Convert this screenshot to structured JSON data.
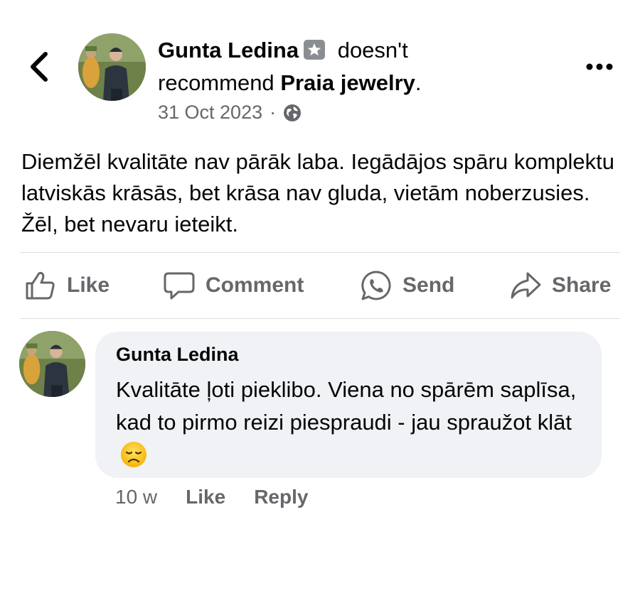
{
  "post": {
    "author": "Gunta Ledina",
    "verb": "doesn't",
    "recommend_word": "recommend",
    "page": "Praia jewelry",
    "page_suffix": ".",
    "date": "31 Oct 2023",
    "date_separator": "·",
    "privacy_icon": "globe-icon",
    "text": "Diemžēl kvalitāte nav pārāk laba. Iegādājos spāru komplektu latviskās krāsās, bet krāsa nav gluda, vietām noberzusies. Žēl, bet nevaru ieteikt."
  },
  "actions": [
    {
      "label": "Like",
      "icon": "thumbs-up-icon"
    },
    {
      "label": "Comment",
      "icon": "comment-icon"
    },
    {
      "label": "Send",
      "icon": "messenger-icon"
    },
    {
      "label": "Share",
      "icon": "share-icon"
    }
  ],
  "comment": {
    "author": "Gunta Ledina",
    "text": "Kvalitāte ļoti pieklibo. Viena no spārēm saplīsa, kad to pirmo reizi piespraudi - jau spraužot klāt",
    "emoji_icon": "disappointed-face-icon",
    "time": "10 w",
    "like_label": "Like",
    "reply_label": "Reply"
  },
  "colors": {
    "text": "#050505",
    "secondary_text": "#65676b",
    "bubble": "#f0f2f5",
    "divider": "#dcdde1"
  }
}
